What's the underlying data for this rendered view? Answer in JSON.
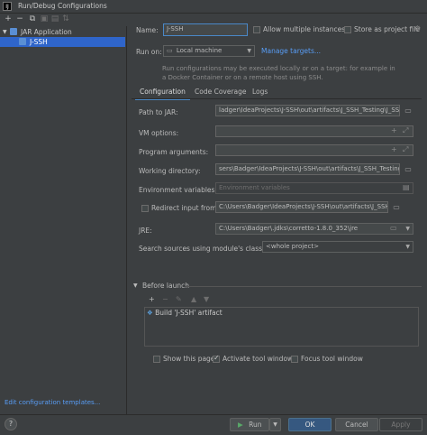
{
  "window": {
    "title": "Run/Debug Configurations",
    "logo": "IJ"
  },
  "toolbar": {
    "add": "+",
    "remove": "−",
    "copy": "⧉",
    "save": "▣",
    "move": "▤",
    "sort": "⇅"
  },
  "tree": {
    "group": "JAR Application",
    "item": "J-SSH"
  },
  "left_footer": {
    "edit_templates": "Edit configuration templates..."
  },
  "form": {
    "name_label": "Name:",
    "name_value": "J-SSH",
    "allow_multiple": "Allow multiple instances",
    "store_as_file": "Store as project file",
    "run_on_label": "Run on:",
    "run_on_value": "Local machine",
    "manage_targets": "Manage targets...",
    "hint": "Run configurations may be executed locally or on a target: for example in a Docker Container or on a remote host using SSH."
  },
  "tabs": [
    "Configuration",
    "Code Coverage",
    "Logs"
  ],
  "config": {
    "path_to_jar_label": "Path to JAR:",
    "path_to_jar_value": "ladger\\IdeaProjects\\J-SSH\\out\\artifacts\\J_SSH_Testing\\J_SSH.jar",
    "vm_options_label": "VM options:",
    "program_args_label": "Program arguments:",
    "working_dir_label": "Working directory:",
    "working_dir_value": "sers\\Badger\\IdeaProjects\\J-SSH\\out\\artifacts\\J_SSH_Testing",
    "env_vars_label": "Environment variables:",
    "env_vars_placeholder": "Environment variables",
    "redirect_input_label": "Redirect input from:",
    "redirect_input_value": "C:\\Users\\Badger\\IdeaProjects\\J-SSH\\out\\artifacts\\J_SSH_Testing\\J_SSH.jar",
    "jre_label": "JRE:",
    "jre_value": "C:\\Users\\Badger\\.jdks\\corretto-1.8.0_352\\jre",
    "classpath_label": "Search sources using module's classpath:",
    "classpath_value": "<whole project>"
  },
  "before_launch": {
    "title": "Before launch",
    "item": "Build 'J-SSH' artifact"
  },
  "options": {
    "show_page": "Show this page",
    "activate_tool": "Activate tool window",
    "focus_tool": "Focus tool window"
  },
  "buttons": {
    "help": "?",
    "run": "Run",
    "ok": "OK",
    "cancel": "Cancel",
    "apply": "Apply"
  },
  "colors": {
    "background": "#3c3f41",
    "selection": "#2f65ca",
    "link": "#589df6",
    "ok_button": "#365880",
    "run_icon": "#59a869"
  }
}
